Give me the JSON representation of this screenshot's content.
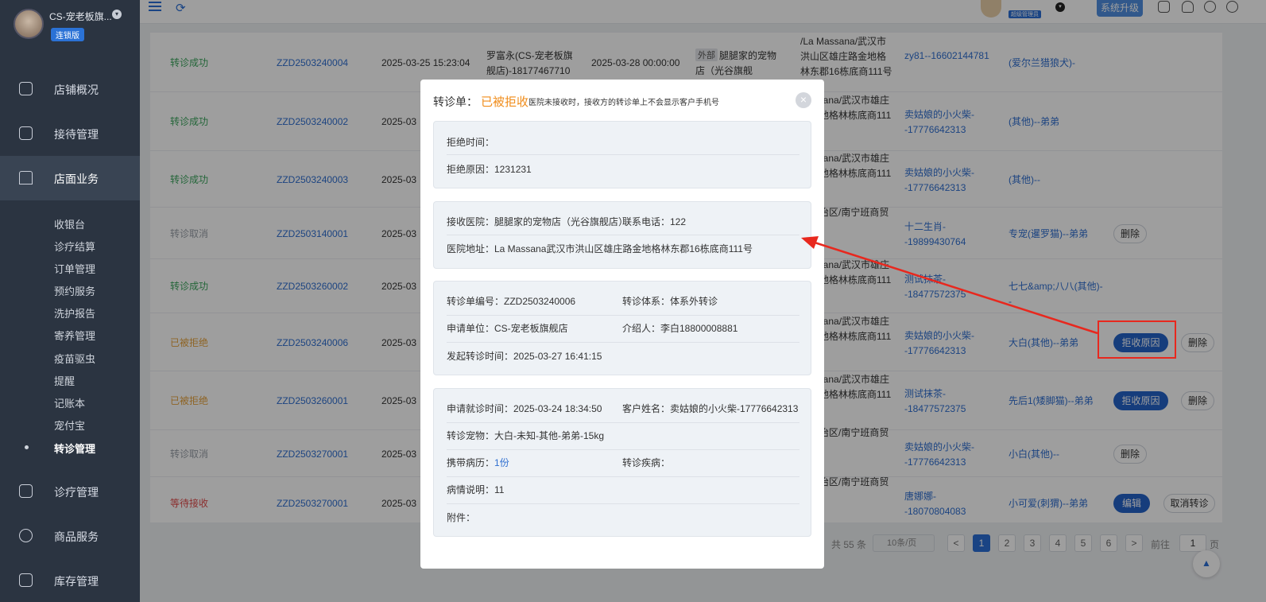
{
  "sidebar": {
    "shop_name": "CS-宠老板旗...",
    "edition": "连锁版",
    "nav": [
      {
        "label": "店铺概况",
        "icon": "chart-icon"
      },
      {
        "label": "接待管理",
        "icon": "reception-icon"
      },
      {
        "label": "店面业务",
        "icon": "store-icon"
      },
      {
        "label": "诊疗管理",
        "icon": "medical-icon"
      },
      {
        "label": "商品服务",
        "icon": "product-icon"
      },
      {
        "label": "库存管理",
        "icon": "inventory-icon"
      }
    ],
    "sub_items": [
      "收银台",
      "诊疗结算",
      "订单管理",
      "预约服务",
      "洗护报告",
      "寄养管理",
      "疫苗驱虫",
      "提醒",
      "记账本",
      "宠付宝",
      "转诊管理"
    ],
    "active_sub": "转诊管理"
  },
  "topbar": {
    "role_badge": "超级管理员",
    "upgrade_label": "系统升级",
    "icons": [
      "menu-icon",
      "refresh-icon",
      "calendar-icon",
      "bell-icon",
      "headset-icon",
      "clock-icon"
    ]
  },
  "table": {
    "rows": [
      {
        "status": "转诊成功",
        "status_type": "ok",
        "no": "ZZD2503240004",
        "time": "2025-03-25 15:23:04",
        "applicant": "罗富永(CS-宠老板旗舰店)-18177467710",
        "time2": "2025-03-28 00:00:00",
        "tag": "外部",
        "hospital": "腿腿家的宠物店（光谷旗舰店）-122",
        "address": "/La Massana/武汉市洪山区雄庄路金地格林东郡16栋底商111号",
        "customer": "zy81--16602144781",
        "pet": "(爱尔兰猎狼犬)-"
      },
      {
        "status": "转诊成功",
        "status_type": "ok",
        "no": "ZZD2503240002",
        "time": "2025-03",
        "address": "Massana/武汉市雄庄路金地格林栋底商111号",
        "customer": "卖姑娘的小火柴--17776642313",
        "pet": "(其他)--弟弟"
      },
      {
        "status": "转诊成功",
        "status_type": "ok",
        "no": "ZZD2503240003",
        "time": "2025-03",
        "address": "Massana/武汉市雄庄路金地格林栋底商111号",
        "customer": "卖姑娘的小火柴--17776642313",
        "pet": "(其他)--"
      },
      {
        "status": "转诊取消",
        "status_type": "cancel",
        "no": "ZZD2503140001",
        "time": "2025-03",
        "address": "族自治区/南宁班商贸城",
        "customer": "十二生肖--19899430764",
        "pet": "专宠(暹罗猫)--弟弟",
        "btn_del": "删除"
      },
      {
        "status": "转诊成功",
        "status_type": "ok",
        "no": "ZZD2503260002",
        "time": "2025-03",
        "address": "Massana/武汉市雄庄路金地格林栋底商111号",
        "customer": "测试抹茶--18477572375",
        "pet": "七七&amp;八八(其他)--"
      },
      {
        "status": "已被拒绝",
        "status_type": "rej",
        "no": "ZZD2503240006",
        "time": "2025-03",
        "address": "Massana/武汉市雄庄路金地格林栋底商111号",
        "customer": "卖姑娘的小火柴--17776642313",
        "pet": "大白(其他)--弟弟",
        "btn_reason": "拒收原因",
        "btn_del": "删除"
      },
      {
        "status": "已被拒绝",
        "status_type": "rej",
        "no": "ZZD2503260001",
        "time": "2025-03",
        "address": "Massana/武汉市雄庄路金地格林栋底商111号",
        "customer": "测试抹茶--18477572375",
        "pet": "先后1(矮脚猫)--弟弟",
        "btn_reason": "拒收原因",
        "btn_del": "删除"
      },
      {
        "status": "转诊取消",
        "status_type": "cancel",
        "no": "ZZD2503270001",
        "time": "2025-03",
        "address": "族自治区/南宁班商贸城",
        "customer": "卖姑娘的小火柴--17776642313",
        "pet": "小白(其他)--",
        "btn_del": "删除"
      },
      {
        "status": "等待接收",
        "status_type": "wait",
        "no": "ZZD2503270001",
        "time": "2025-03",
        "address": "族自治区/南宁班商贸城",
        "customer": "唐娜娜--18070804083",
        "pet": "小可爱(刺猬)--弟弟",
        "btn_edit": "编辑",
        "btn_cancel": "取消转诊"
      }
    ]
  },
  "pager": {
    "total": "共 55 条",
    "size": "10条/页",
    "pages": [
      "1",
      "2",
      "3",
      "4",
      "5",
      "6"
    ],
    "current": "1",
    "prev": "<",
    "next": ">",
    "goto": "前往",
    "goto_value": "1",
    "unit": "页"
  },
  "modal": {
    "title": "转诊单：",
    "status": "已被拒收",
    "note": "医院未接收时，接收方的转诊单上不会显示客户手机号",
    "reject_time": "拒绝时间：",
    "reject_reason": "拒绝原因：1231231",
    "recv_hospital": "接收医院：腿腿家的宠物店（光谷旗舰店）",
    "phone": "联系电话：122",
    "address": "医院地址：La Massana武汉市洪山区雄庄路金地格林东郡16栋底商111号",
    "order_no": "转诊单编号：ZZD2503240006",
    "system": "转诊体系：体系外转诊",
    "unit": "申请单位：CS-宠老板旗舰店",
    "referrer": "介绍人：李白18800008881",
    "sent_time": "发起转诊时间：2025-03-27 16:41:15",
    "visit_time": "申请就诊时间：2025-03-24 18:34:50",
    "customer": "客户姓名：卖姑娘的小火柴-17776642313",
    "pet": "转诊宠物：大白-未知-其他-弟弟-15kg",
    "record_label": "携带病历：",
    "record_value": "1份",
    "disease": "转诊疾病：",
    "desc": "病情说明：11",
    "attach": "附件："
  },
  "colors": {
    "sidebar": "#2b3441",
    "primary": "#2563c9",
    "warn": "#f08c1a",
    "annotation": "#e8281e"
  }
}
